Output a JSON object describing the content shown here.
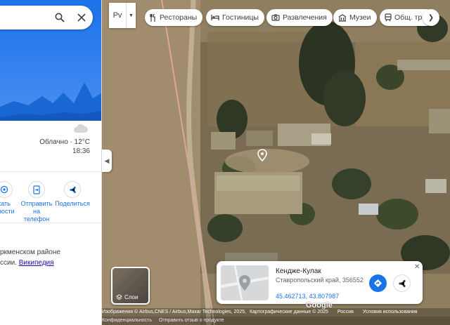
{
  "search": {
    "search_icon": "search-icon",
    "close_icon": "close-icon"
  },
  "weather": {
    "icon": "cloud-icon",
    "condition": "Облачно · 12°C",
    "time": "18:36"
  },
  "actions": [
    {
      "icon": "nearby-icon",
      "line1": "кать",
      "line2": "юзости"
    },
    {
      "icon": "send-to-phone-icon",
      "line1": "Отправить",
      "line2": "на телефон"
    },
    {
      "icon": "share-icon",
      "line1": "Поделиться",
      "line2": ""
    }
  ],
  "description": {
    "line1": "ркменском районе",
    "line2_prefix": "ссии. ",
    "link": "Википедия"
  },
  "map_type": {
    "label": "Рv",
    "dropdown_icon": "chevron-down-icon"
  },
  "chips": [
    {
      "icon": "restaurant-icon",
      "label": "Рестораны"
    },
    {
      "icon": "hotel-icon",
      "label": "Гостиницы"
    },
    {
      "icon": "camera-icon",
      "label": "Развлечения"
    },
    {
      "icon": "museum-icon",
      "label": "Музеи"
    },
    {
      "icon": "transit-icon",
      "label": "Общ. тр"
    }
  ],
  "layers": {
    "label": "Слои",
    "icon": "layers-icon"
  },
  "place_card": {
    "name": "Кендже-Кулак",
    "address": "Ставропольский край, 356552",
    "coords": "45.462713, 43.807987",
    "close_icon": "close-icon",
    "directions_icon": "directions-icon",
    "share_icon": "share-icon"
  },
  "attribution": {
    "imagery": "Изображения © Airbus,CNES / Airbus,Maxar Technologies, 2025,",
    "map_data": "Картографические данные © 2025",
    "country": "Россия",
    "terms": "Условия использования",
    "privacy": "Конфиденциальность",
    "feedback": "Отправить отзыв о продукте",
    "google": "Google"
  },
  "colors": {
    "accent": "#1a73e8"
  }
}
